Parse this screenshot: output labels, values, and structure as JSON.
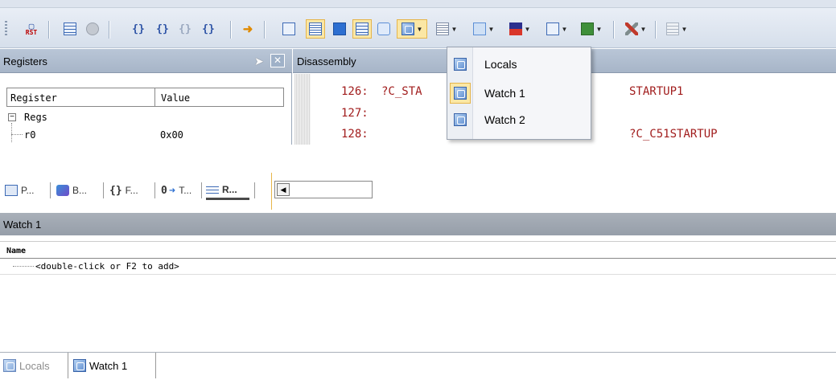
{
  "toolbar": {
    "rst_label_top": "RST",
    "items": [
      {
        "name": "reset-icon"
      },
      {
        "name": "run-icon"
      },
      {
        "name": "stop-icon"
      },
      {
        "name": "step-into-icon"
      },
      {
        "name": "step-over-icon"
      },
      {
        "name": "step-out-icon"
      },
      {
        "name": "run-to-cursor-icon"
      },
      {
        "name": "show-next-statement-icon"
      },
      {
        "name": "command-window-icon"
      },
      {
        "name": "disassembly-window-icon"
      },
      {
        "name": "symbols-window-icon"
      },
      {
        "name": "registers-window-icon"
      },
      {
        "name": "call-stack-window-icon"
      },
      {
        "name": "watch-windows-icon"
      },
      {
        "name": "memory-windows-icon"
      },
      {
        "name": "serial-windows-icon"
      },
      {
        "name": "analysis-windows-icon"
      },
      {
        "name": "trace-windows-icon"
      },
      {
        "name": "system-viewer-icon"
      },
      {
        "name": "toolbox-icon"
      },
      {
        "name": "debug-restore-icon"
      }
    ],
    "colors": {
      "active_bg": "#fbe7a5",
      "active_border": "#e5b54b"
    }
  },
  "registers": {
    "title": "Registers",
    "col_register": "Register",
    "col_value": "Value",
    "group": "Regs",
    "rows": [
      {
        "name": "r0",
        "value": "0x00"
      }
    ]
  },
  "disassembly": {
    "title": "Disassembly",
    "lines": [
      {
        "num": "126:",
        "label": "?C_STA",
        "operand": "STARTUP1"
      },
      {
        "num": "127:",
        "label": "",
        "operand": ""
      },
      {
        "num": "128:",
        "label": "",
        "operand": "?C_C51STARTUP"
      }
    ]
  },
  "menu": {
    "items": [
      {
        "label": "Locals"
      },
      {
        "label": "Watch 1"
      },
      {
        "label": "Watch 2"
      }
    ]
  },
  "project_tabs": [
    {
      "label": "P..."
    },
    {
      "label": "B..."
    },
    {
      "label": "F..."
    },
    {
      "label": "T..."
    },
    {
      "label": "R..."
    }
  ],
  "watch": {
    "title": "Watch 1",
    "col_name": "Name",
    "placeholder_row": "<double-click or F2 to add>"
  },
  "bottom_tabs": [
    {
      "label": "Locals"
    },
    {
      "label": "Watch 1"
    }
  ]
}
